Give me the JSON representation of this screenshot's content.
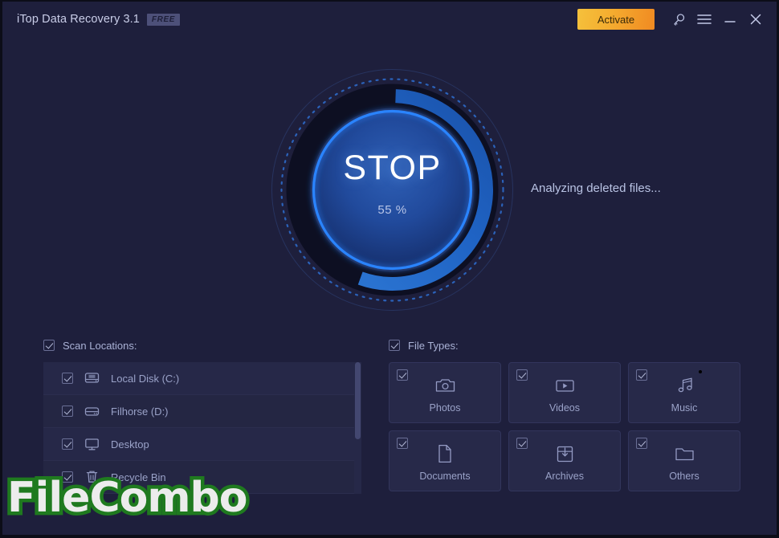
{
  "window": {
    "title": "iTop Data Recovery 3.1",
    "badge": "FREE",
    "bg_color": "#1e1f3c"
  },
  "titlebar": {
    "activate_label": "Activate",
    "icons": {
      "key": "key-icon",
      "menu": "hamburger-menu-icon",
      "minimize": "minimize-icon",
      "close": "close-icon"
    }
  },
  "scan": {
    "button_label": "STOP",
    "percent_label": "55 %",
    "percent_value": 55,
    "status": "Analyzing deleted files...",
    "accent_color": "#2a7fff",
    "arc_color": "#1e6ed0",
    "track_color": "#0d0f22"
  },
  "locations": {
    "header": "Scan Locations:",
    "items": [
      {
        "label": "Local Disk (C:)",
        "icon": "hard-drive-icon",
        "checked": true
      },
      {
        "label": "Filhorse (D:)",
        "icon": "drive-icon",
        "checked": true
      },
      {
        "label": "Desktop",
        "icon": "monitor-icon",
        "checked": true
      },
      {
        "label": "Recycle Bin",
        "icon": "trash-icon",
        "checked": true
      }
    ]
  },
  "filetypes": {
    "header": "File Types:",
    "items": [
      {
        "label": "Photos",
        "icon": "camera-icon",
        "checked": true
      },
      {
        "label": "Videos",
        "icon": "video-play-icon",
        "checked": true
      },
      {
        "label": "Music",
        "icon": "music-note-icon",
        "checked": true
      },
      {
        "label": "Documents",
        "icon": "document-icon",
        "checked": true
      },
      {
        "label": "Archives",
        "icon": "archive-box-icon",
        "checked": true
      },
      {
        "label": "Others",
        "icon": "folder-icon",
        "checked": true
      }
    ]
  },
  "watermark": {
    "text": "FileCombo"
  }
}
